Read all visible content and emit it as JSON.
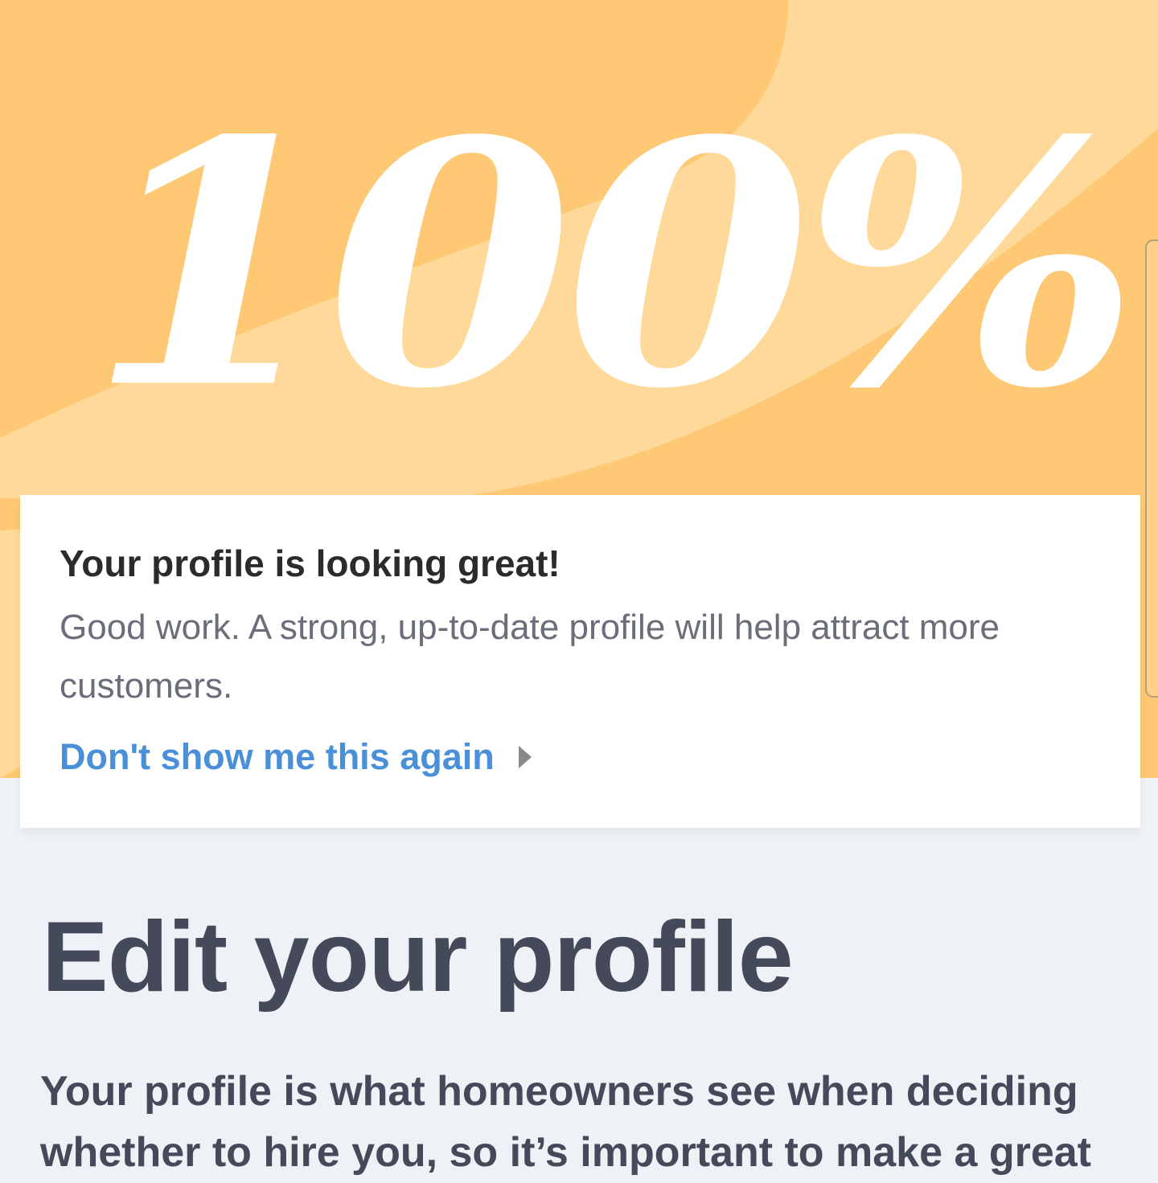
{
  "banner": {
    "headline": "100%"
  },
  "completion_card": {
    "title": "Your profile is looking great!",
    "body": "Good work. A strong, up-to-date profile will help attract more customers.",
    "dismiss_link": "Don't show me this again"
  },
  "page": {
    "title": "Edit your profile",
    "intro": "Your profile is what homeowners see when deciding whether to hire you, so it’s important to make a great"
  },
  "colors": {
    "banner_base": "#fec875",
    "banner_highlight": "#ffd999",
    "link": "#4a90d9",
    "title_text": "#454a5b",
    "page_background": "#eef1f6"
  },
  "icons": {
    "dismiss_link_arrow": "caret-right-icon"
  }
}
